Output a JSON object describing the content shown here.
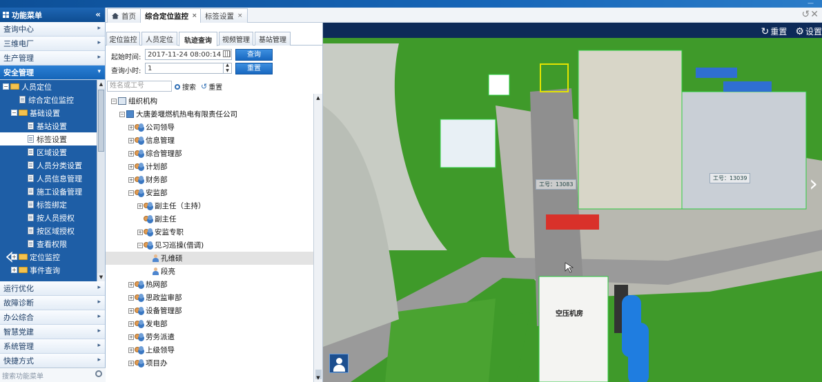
{
  "header": {
    "sidebar_title": "功能菜单",
    "collapse_glyph": "«"
  },
  "sidebar": {
    "top_items": [
      {
        "label": "查询中心"
      },
      {
        "label": "三维电厂"
      },
      {
        "label": "生产管理"
      },
      {
        "label": "安全管理"
      }
    ],
    "tree": {
      "personnel": "人员定位",
      "integrated": "综合定位监控",
      "base_settings": "基础设置",
      "station": "基站设置",
      "tag": "标签设置",
      "area": "区域设置",
      "person_category": "人员分类设置",
      "person_info": "人员信息管理",
      "equipment": "施工设备管理",
      "tag_bind": "标签绑定",
      "auth_person": "按人员授权",
      "auth_area": "按区域授权",
      "view_perm": "查看权限",
      "location_monitor": "定位监控",
      "event_query": "事件查询"
    },
    "bottom_items": [
      {
        "label": "运行优化"
      },
      {
        "label": "故障诊断"
      },
      {
        "label": "办公综合"
      },
      {
        "label": "智慧党建"
      },
      {
        "label": "系统管理"
      },
      {
        "label": "快捷方式"
      }
    ],
    "search_placeholder": "搜索功能菜单"
  },
  "tabs": [
    {
      "label": "首页"
    },
    {
      "label": "综合定位监控"
    },
    {
      "label": "标签设置"
    }
  ],
  "subtabs": [
    "定位监控",
    "人员定位",
    "轨迹查询",
    "视频管理",
    "基站管理"
  ],
  "form": {
    "start_label": "起始时间:",
    "start_value": "2017-11-24 08:00:14",
    "hours_label": "查询小时:",
    "hours_value": "1",
    "query_btn": "查询",
    "reset_btn": "重置"
  },
  "search": {
    "placeholder": "姓名或工号",
    "search_btn": "搜索",
    "reset_btn": "重置"
  },
  "org_tree": {
    "root": "组织机构",
    "company": "大唐姜堰燃机热电有限责任公司",
    "depts": [
      "公司领导",
      "信息管理",
      "综合管理部",
      "计划部",
      "财务部",
      "安监部"
    ],
    "anjian_children": [
      "副主任（主持）",
      "副主任",
      "安监专职",
      "见习巡操(借调)"
    ],
    "persons": [
      "孔维硕",
      "段亮"
    ],
    "more_depts": [
      "热网部",
      "思政监审部",
      "设备管理部",
      "发电部",
      "劳务派遣",
      "上级领导",
      "项目办"
    ]
  },
  "view": {
    "reset_label": "重置",
    "settings_label": "设置",
    "tag1": "工号：13083",
    "tag2": "工号：13039",
    "room_label": "空压机房"
  },
  "colors": {
    "accent": "#1565b8",
    "sidebar_tree_bg": "#1e5ea6",
    "button_blue": "#1868c0",
    "grass": "#3f9a2a"
  }
}
